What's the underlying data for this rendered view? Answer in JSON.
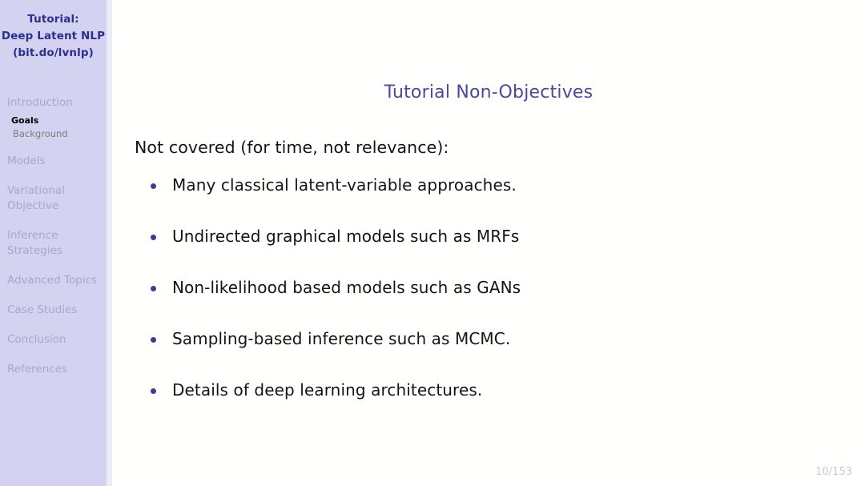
{
  "sidebar": {
    "header_lines": [
      "Tutorial:",
      "Deep Latent NLP",
      "(bit.do/lvnlp)"
    ],
    "nav": [
      {
        "label": "Introduction",
        "state": "inactive"
      },
      {
        "label": "Models",
        "state": "inactive"
      },
      {
        "label": "Variational Objective",
        "state": "inactive"
      },
      {
        "label": "Inference Strategies",
        "state": "inactive"
      },
      {
        "label": "Advanced Topics",
        "state": "inactive"
      },
      {
        "label": "Case Studies",
        "state": "inactive"
      },
      {
        "label": "Conclusion",
        "state": "inactive"
      },
      {
        "label": "References",
        "state": "inactive"
      }
    ],
    "subnav": [
      {
        "label": "Goals",
        "state": "active"
      },
      {
        "label": "Background",
        "state": "inactive"
      }
    ]
  },
  "main": {
    "title": "Tutorial Non-Objectives",
    "lead": "Not covered (for time, not relevance):",
    "bullets": [
      "Many classical latent-variable approaches.",
      "Undirected graphical models such as MRFs",
      "Non-likelihood based models such as GANs",
      "Sampling-based inference such as MCMC.",
      "Details of deep learning architectures."
    ]
  },
  "footer": {
    "page_indicator": "10/153"
  },
  "colors": {
    "sidebar_background": "#d3d2f0",
    "sidebar_header_text": "#2e2e8f",
    "nav_inactive_text": "#a8a6cf",
    "nav_active_text": "#000000",
    "nav_sub_text": "#7d7d7d",
    "title_text": "#4a4a9c",
    "body_text": "#141414",
    "bullet_marker": "#3b3b9e",
    "page_indicator_text": "#c9c7e6",
    "content_background": "#fffffe"
  }
}
